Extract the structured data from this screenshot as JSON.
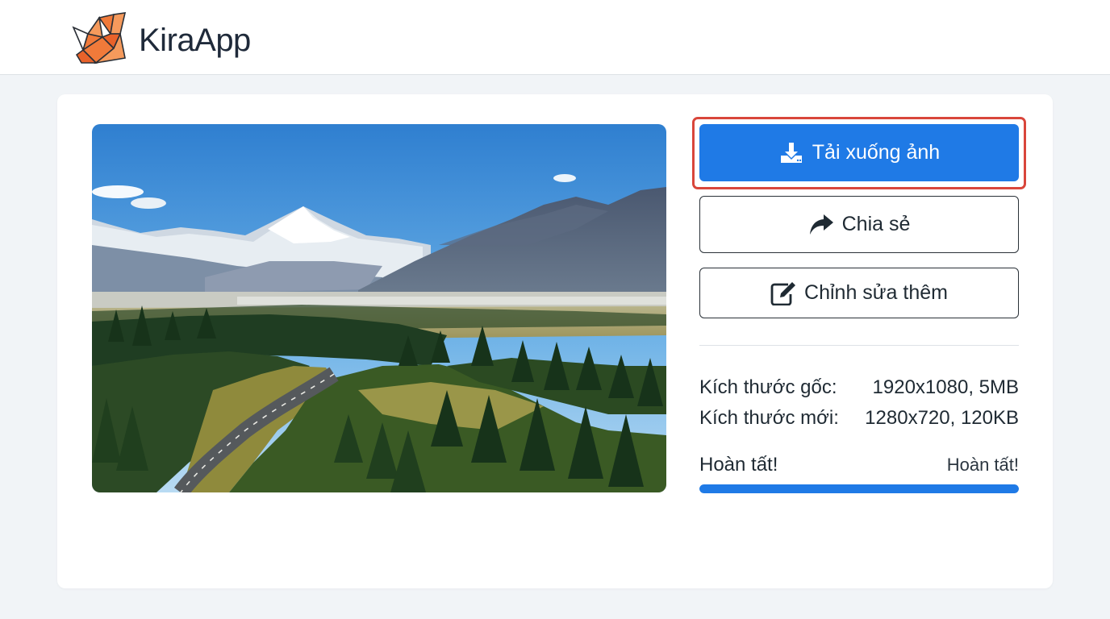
{
  "app": {
    "brand": "KiraApp",
    "logo_icon": "fox-icon",
    "accent_color": "#1f7ae6",
    "focus_color": "#d9463b"
  },
  "preview": {
    "image_icon": "landscape-photo"
  },
  "actions": {
    "download_label": "Tải xuống ảnh",
    "download_icon": "download-icon",
    "share_label": "Chia sẻ",
    "share_icon": "share-arrow-icon",
    "edit_label": "Chỉnh sửa thêm",
    "edit_icon": "edit-icon"
  },
  "info": {
    "original_label": "Kích thước gốc:",
    "original_value": "1920x1080, 5MB",
    "new_label": "Kích thước mới:",
    "new_value": "1280x720, 120KB"
  },
  "status": {
    "left_text": "Hoàn tất!",
    "right_text": "Hoàn tất!",
    "progress_percent": 100
  }
}
